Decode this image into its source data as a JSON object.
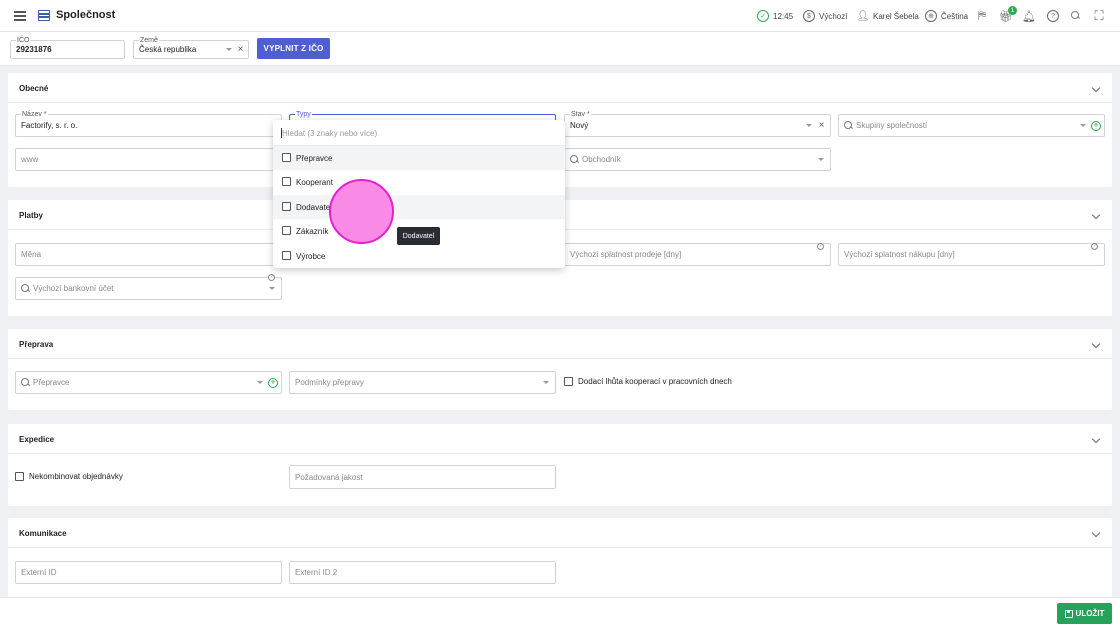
{
  "header": {
    "title": "Společnost",
    "time": "12:45",
    "currency": "Výchozí",
    "user": "Karel Šebela",
    "language": "Čeština",
    "notification_count": "1"
  },
  "ico_row": {
    "ico_label": "IČO",
    "ico_value": "29231876",
    "country_label": "Země",
    "country_value": "Česká republika",
    "fill_button": "VYPLNIT Z IČO"
  },
  "sections": {
    "general": {
      "title": "Obecné",
      "name_label": "Název *",
      "name_value": "Factorify, s. r. o.",
      "types_label": "Typy",
      "state_label": "Stav *",
      "state_value": "Nový",
      "groups_placeholder": "Skupiny společností",
      "www_placeholder": "www",
      "salesman_placeholder": "Obchodník"
    },
    "payments": {
      "title": "Platby",
      "currency_placeholder": "Měna",
      "sale_due_placeholder": "Výchozí splatnost prodeje [dny]",
      "purchase_due_placeholder": "Výchozí splatnost nákupu [dny]",
      "bank_account_placeholder": "Výchozí bankovní účet"
    },
    "transport": {
      "title": "Přeprava",
      "carrier_placeholder": "Přepravce",
      "conditions_placeholder": "Podmínky přepravy",
      "cooperation_label": "Dodací lhůta kooperací v pracovních dnech"
    },
    "expedition": {
      "title": "Expedice",
      "no_combine_label": "Nekombinovat objednávky",
      "quality_placeholder": "Požadovaná jakost"
    },
    "communication": {
      "title": "Komunikace",
      "ext_id_placeholder": "Externí ID",
      "ext_id2_placeholder": "Externí ID 2"
    }
  },
  "types_dropdown": {
    "search_placeholder": "Hledat (3 znaky nebo více)",
    "options": [
      "Přepravce",
      "Kooperant",
      "Dodavatel",
      "Zákazník",
      "Výrobce"
    ]
  },
  "tooltip": "Dodavatel",
  "footer": {
    "save_label": "ULOŽIT"
  },
  "colors": {
    "primary": "#4f5fd1",
    "success": "#27a25a",
    "cursor_highlight": "#f98be6"
  }
}
